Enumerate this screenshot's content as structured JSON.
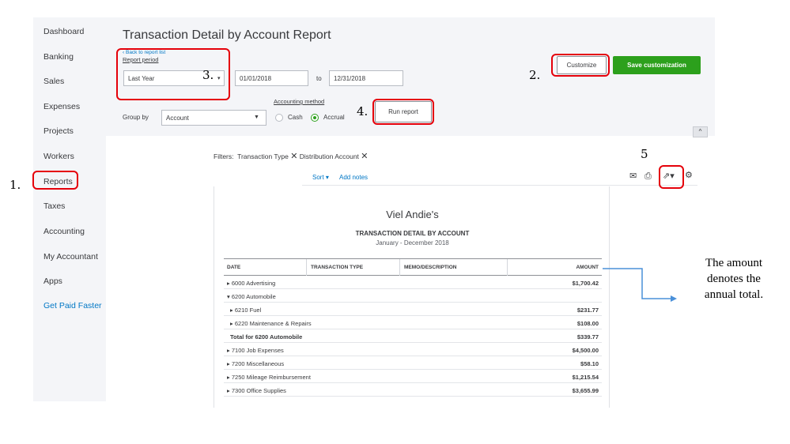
{
  "sidebar": {
    "items": [
      {
        "label": "Dashboard"
      },
      {
        "label": "Banking"
      },
      {
        "label": "Sales"
      },
      {
        "label": "Expenses"
      },
      {
        "label": "Projects"
      },
      {
        "label": "Workers"
      },
      {
        "label": "Reports"
      },
      {
        "label": "Taxes"
      },
      {
        "label": "Accounting"
      },
      {
        "label": "My Accountant"
      },
      {
        "label": "Apps"
      },
      {
        "label": "Get Paid Faster"
      }
    ]
  },
  "header": {
    "title": "Transaction Detail by Account Report",
    "back_link": "Back to report list",
    "report_period_label": "Report period",
    "period_value": "Last Year",
    "date_from": "01/01/2018",
    "to_label": "to",
    "date_to": "12/31/2018",
    "accounting_method_label": "Accounting method",
    "group_by_label": "Group by",
    "group_by_value": "Account",
    "cash_label": "Cash",
    "accrual_label": "Accrual",
    "run_report_label": "Run report",
    "customize_label": "Customize",
    "save_customization_label": "Save customization"
  },
  "filters": {
    "label": "Filters:",
    "items": [
      "Transaction Type",
      "Distribution Account"
    ]
  },
  "toolbar": {
    "sort_label": "Sort",
    "add_notes_label": "Add notes"
  },
  "report": {
    "company": "Viel Andie's",
    "title": "TRANSACTION DETAIL BY ACCOUNT",
    "dates": "January - December 2018",
    "columns": [
      "DATE",
      "TRANSACTION TYPE",
      "MEMO/DESCRIPTION",
      "AMOUNT"
    ],
    "rows": [
      {
        "label": "6000 Advertising",
        "amount": "$1,700.42",
        "caret": "▸"
      },
      {
        "label": "6200 Automobile",
        "amount": "",
        "caret": "▾"
      },
      {
        "label": "6210 Fuel",
        "amount": "$231.77",
        "caret": "▸"
      },
      {
        "label": "6220 Maintenance & Repairs",
        "amount": "$108.00",
        "caret": "▸"
      },
      {
        "label": "Total for 6200 Automobile",
        "amount": "$339.77",
        "caret": ""
      },
      {
        "label": "7100 Job Expenses",
        "amount": "$4,500.00",
        "caret": "▸"
      },
      {
        "label": "7200 Miscellaneous",
        "amount": "$58.10",
        "caret": "▸"
      },
      {
        "label": "7250 Mileage Reimbursement",
        "amount": "$1,215.54",
        "caret": "▸"
      },
      {
        "label": "7300 Office Supplies",
        "amount": "$3,655.99",
        "caret": "▸"
      }
    ]
  },
  "annotations": {
    "step1": "1.",
    "step2": "2.",
    "step3": "3.",
    "step4": "4.",
    "step5": "5",
    "note_lines": [
      "The amount",
      "denotes the",
      "annual total."
    ]
  },
  "colors": {
    "accent_red": "#e5000a",
    "brand_green": "#2ca01c",
    "link_blue": "#0077c5",
    "arrow_blue": "#4a90d9"
  },
  "icons": {
    "email": "envelope-icon",
    "print": "printer-icon",
    "export": "export-icon",
    "settings": "gear-icon"
  }
}
